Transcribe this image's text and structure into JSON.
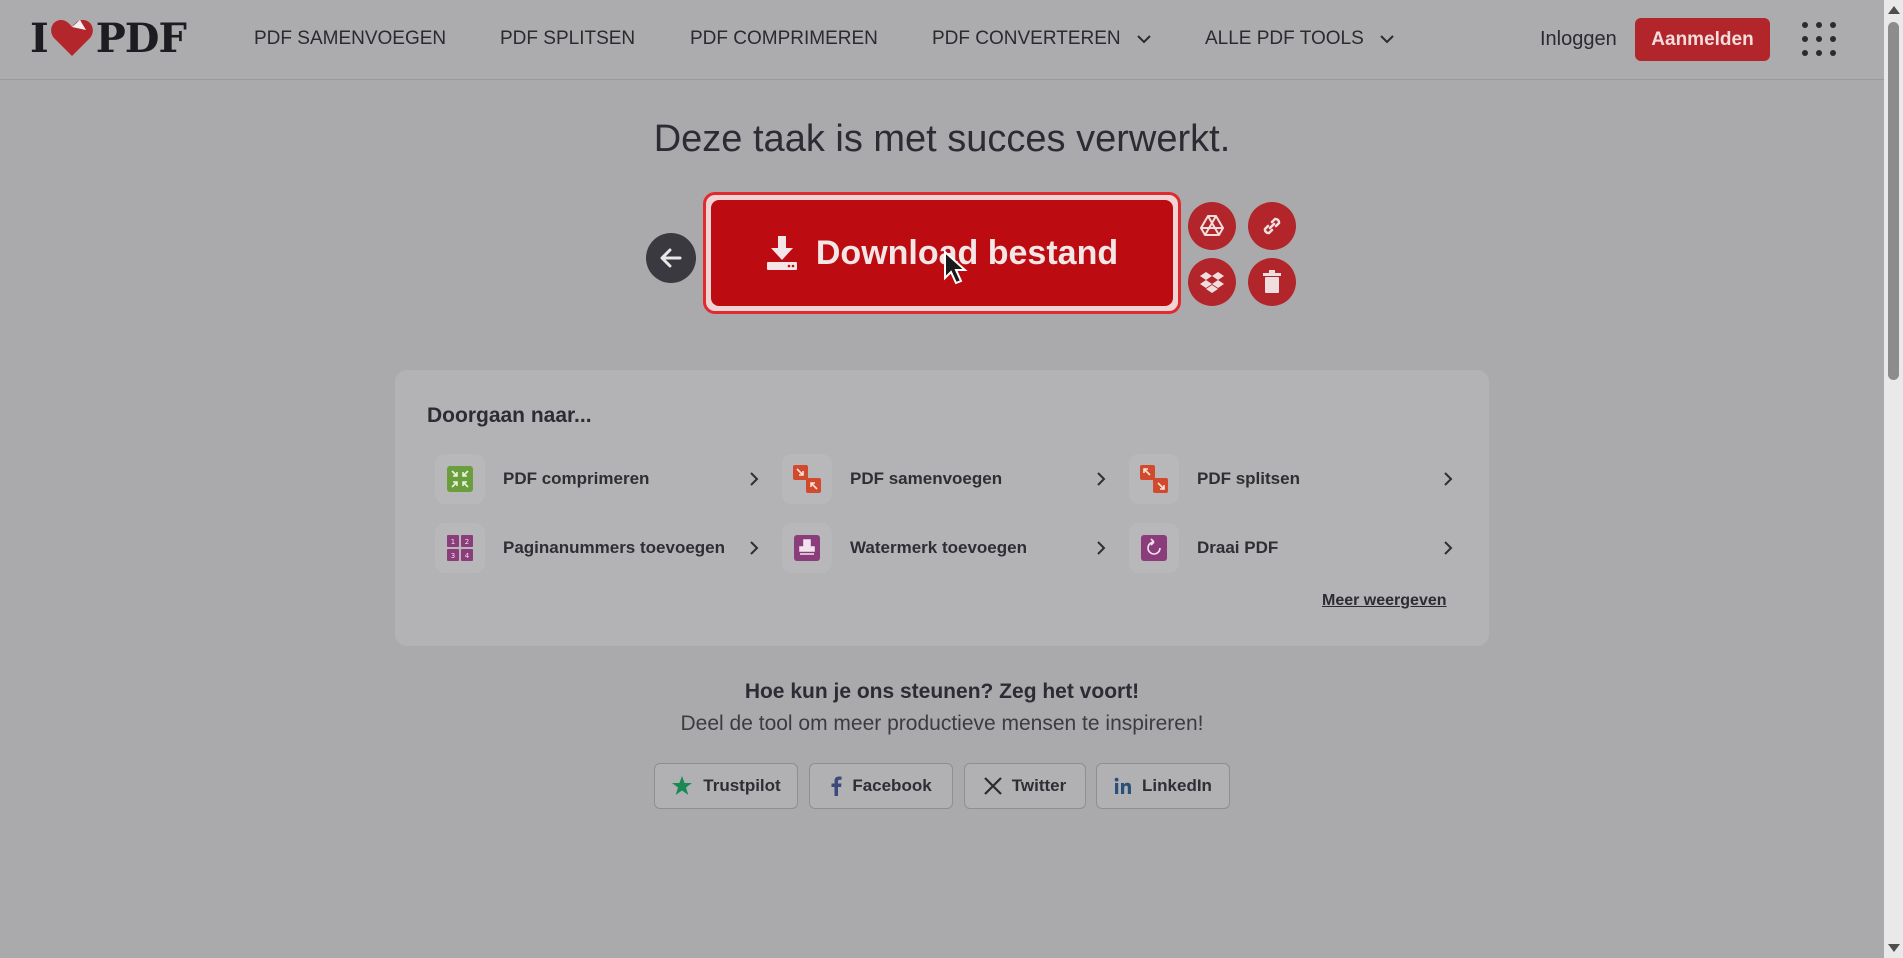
{
  "header": {
    "logo_left": "I",
    "logo_right": "PDF",
    "nav": [
      {
        "label": "PDF SAMENVOEGEN",
        "dropdown": false
      },
      {
        "label": "PDF SPLITSEN",
        "dropdown": false
      },
      {
        "label": "PDF COMPRIMEREN",
        "dropdown": false
      },
      {
        "label": "PDF CONVERTEREN",
        "dropdown": true
      },
      {
        "label": "ALLE PDF TOOLS",
        "dropdown": true
      }
    ],
    "login": "Inloggen",
    "signup": "Aanmelden"
  },
  "main": {
    "title": "Deze taak is met succes verwerkt.",
    "download_label": "Download bestand",
    "side_actions": [
      "google-drive-icon",
      "link-icon",
      "dropbox-icon",
      "trash-icon"
    ]
  },
  "continue": {
    "title": "Doorgaan naar...",
    "tools": [
      {
        "label": "PDF comprimeren",
        "icon": "compress-icon",
        "color": "#6a9e3c"
      },
      {
        "label": "PDF samenvoegen",
        "icon": "merge-icon",
        "color": "#d24a2e"
      },
      {
        "label": "PDF splitsen",
        "icon": "split-icon",
        "color": "#d24a2e"
      },
      {
        "label": "Paginanummers toevoegen",
        "icon": "page-numbers-icon",
        "color": "#8a3d7a"
      },
      {
        "label": "Watermerk toevoegen",
        "icon": "stamp-icon",
        "color": "#8a3d7a"
      },
      {
        "label": "Draai PDF",
        "icon": "rotate-icon",
        "color": "#8a3d7a"
      }
    ],
    "more": "Meer weergeven"
  },
  "support": {
    "title": "Hoe kun je ons steunen? Zeg het voort!",
    "subtitle": "Deel de tool om meer productieve mensen te inspireren!",
    "buttons": [
      {
        "label": "Trustpilot",
        "icon": "star-icon"
      },
      {
        "label": "Facebook",
        "icon": "facebook-icon"
      },
      {
        "label": "Twitter",
        "icon": "x-icon"
      },
      {
        "label": "LinkedIn",
        "icon": "linkedin-icon"
      }
    ]
  },
  "colors": {
    "brand": "#b2262b",
    "download": "#bd0c11",
    "overlay": "#aaaaad"
  }
}
